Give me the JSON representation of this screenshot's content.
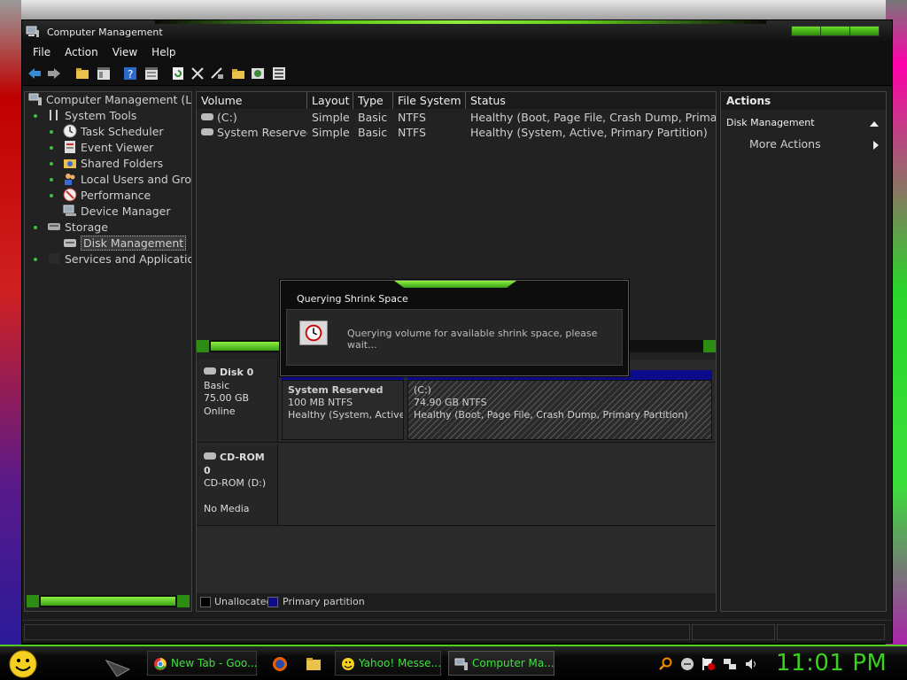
{
  "window": {
    "title": "Computer Management"
  },
  "menu": [
    "File",
    "Action",
    "View",
    "Help"
  ],
  "toolbar": {
    "icons": [
      "back-arrow-icon",
      "forward-arrow-icon",
      "folder-up-icon",
      "show-hide-tree-icon",
      "help-icon",
      "properties-icon",
      "refresh-icon",
      "delete-icon",
      "connect-icon",
      "open-icon",
      "check-icon",
      "settings-icon"
    ]
  },
  "tree": {
    "root": "Computer Management (Loc",
    "system_tools": "System Tools",
    "task_scheduler": "Task Scheduler",
    "event_viewer": "Event Viewer",
    "shared_folders": "Shared Folders",
    "local_users": "Local Users and Grou",
    "performance": "Performance",
    "device_manager": "Device Manager",
    "storage": "Storage",
    "disk_management": "Disk Management",
    "services": "Services and Applications"
  },
  "volumes": {
    "columns": [
      "Volume",
      "Layout",
      "Type",
      "File System",
      "Status"
    ],
    "rows": [
      {
        "volume": "(C:)",
        "layout": "Simple",
        "type": "Basic",
        "fs": "NTFS",
        "status": "Healthy (Boot, Page File, Crash Dump, Primary"
      },
      {
        "volume": "System Reserved",
        "layout": "Simple",
        "type": "Basic",
        "fs": "NTFS",
        "status": "Healthy (System, Active, Primary Partition)"
      }
    ]
  },
  "disks": {
    "disk0": {
      "name": "Disk 0",
      "type": "Basic",
      "size": "75.00 GB",
      "state": "Online"
    },
    "cdrom0": {
      "name": "CD-ROM 0",
      "drive": "CD-ROM (D:)",
      "state": "No Media"
    },
    "partitions": [
      {
        "name": "System Reserved",
        "size": "100 MB NTFS",
        "status": "Healthy (System, Active, P"
      },
      {
        "name": "(C:)",
        "size": "74.90 GB NTFS",
        "status": "Healthy (Boot, Page File, Crash Dump, Primary Partition)"
      }
    ]
  },
  "legend": {
    "unallocated": "Unallocated",
    "primary": "Primary partition",
    "unallocated_color": "#000000",
    "primary_color": "#0b0b8c"
  },
  "actions": {
    "header": "Actions",
    "section": "Disk Management",
    "more": "More Actions"
  },
  "dialog": {
    "title": "Querying Shrink Space",
    "message": "Querying volume for available shrink space, please wait..."
  },
  "taskbar": {
    "buttons": [
      {
        "label": "New Tab - Goo...",
        "icon": "chrome-icon"
      },
      {
        "label": "Yahoo! Messe...",
        "icon": "yahoo-messenger-icon"
      },
      {
        "label": "Computer Ma...",
        "icon": "computer-management-icon"
      }
    ],
    "clock": "11:01 PM"
  },
  "colors": {
    "accent_green": "#3bd01f",
    "window_bg": "#1c1c1c",
    "partition_blue": "#0b0b8c"
  }
}
